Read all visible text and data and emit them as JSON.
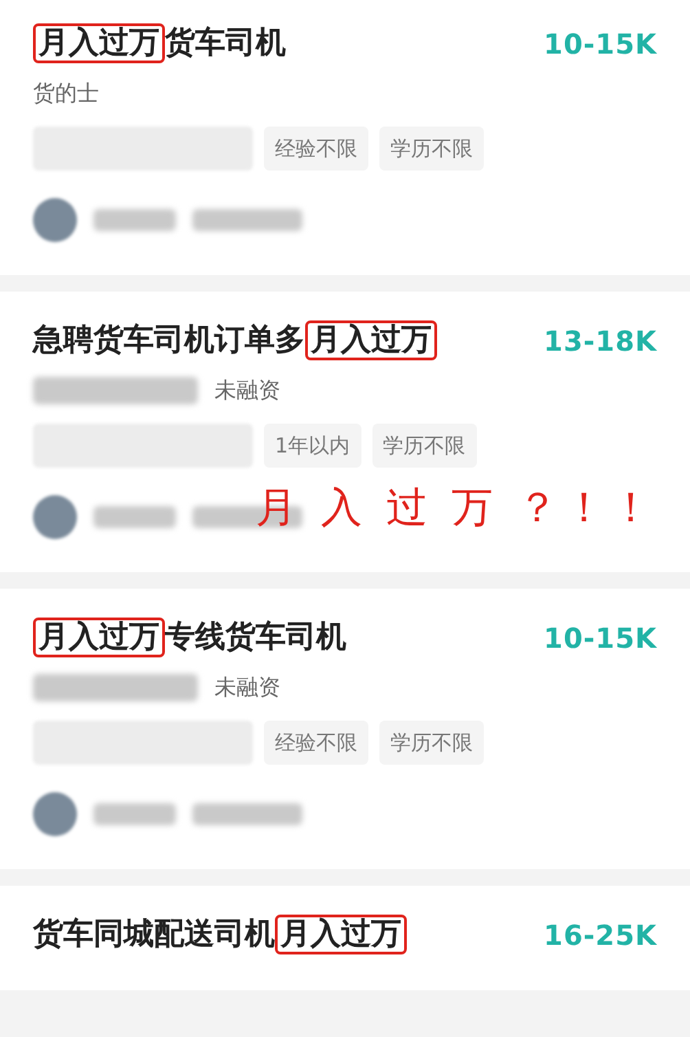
{
  "jobs": [
    {
      "title_parts": [
        {
          "text": "月入过万",
          "boxed": true
        },
        {
          "text": "货车司机",
          "boxed": false
        }
      ],
      "salary": "10-15K",
      "company": {
        "blurred": false,
        "text": "货的士"
      },
      "tags": [
        {
          "kind": "blurred"
        },
        {
          "kind": "text",
          "text": "经验不限"
        },
        {
          "kind": "text",
          "text": "学历不限"
        }
      ],
      "recruiter": true
    },
    {
      "title_parts": [
        {
          "text": "急聘货车司机订单多",
          "boxed": false
        },
        {
          "text": "月入过万",
          "boxed": true
        }
      ],
      "salary": "13-18K",
      "company": {
        "blurred": true,
        "text": "未融资"
      },
      "tags": [
        {
          "kind": "blurred"
        },
        {
          "kind": "text",
          "text": "1年以内"
        },
        {
          "kind": "text",
          "text": "学历不限"
        }
      ],
      "recruiter": true,
      "annotation": "月 入 过 万 ？！！"
    },
    {
      "title_parts": [
        {
          "text": "月入过万",
          "boxed": true
        },
        {
          "text": "专线货车司机",
          "boxed": false
        }
      ],
      "salary": "10-15K",
      "company": {
        "blurred": true,
        "text": "未融资"
      },
      "tags": [
        {
          "kind": "blurred"
        },
        {
          "kind": "text",
          "text": "经验不限"
        },
        {
          "kind": "text",
          "text": "学历不限"
        }
      ],
      "recruiter": true
    },
    {
      "title_parts": [
        {
          "text": "货车同城配送司机",
          "boxed": false
        },
        {
          "text": "月入过万",
          "boxed": true
        }
      ],
      "salary": "16-25K"
    }
  ]
}
